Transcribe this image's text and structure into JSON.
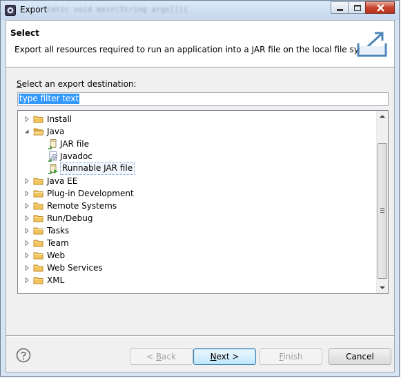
{
  "window": {
    "title": "Export",
    "background_ghost_text": "tatic void main(String args[]){"
  },
  "header": {
    "title": "Select",
    "description": "Export all resources required to run an application into a JAR file on the local file system."
  },
  "destination": {
    "label_mnemonic": "S",
    "label_rest": "elect an export destination:",
    "filter_value": "type filter text"
  },
  "tree": {
    "items": [
      {
        "label": "Install",
        "icon": "folder-icon",
        "state": "collapsed",
        "level": 0
      },
      {
        "label": "Java",
        "icon": "folder-open-icon",
        "state": "expanded",
        "level": 0
      },
      {
        "label": "JAR file",
        "icon": "jar-file-icon",
        "state": "leaf",
        "level": 1
      },
      {
        "label": "Javadoc",
        "icon": "javadoc-icon",
        "state": "leaf",
        "level": 1
      },
      {
        "label": "Runnable JAR file",
        "icon": "runnable-jar-icon",
        "state": "leaf",
        "level": 1,
        "selected": true
      },
      {
        "label": "Java EE",
        "icon": "folder-icon",
        "state": "collapsed",
        "level": 0
      },
      {
        "label": "Plug-in Development",
        "icon": "folder-icon",
        "state": "collapsed",
        "level": 0
      },
      {
        "label": "Remote Systems",
        "icon": "folder-icon",
        "state": "collapsed",
        "level": 0
      },
      {
        "label": "Run/Debug",
        "icon": "folder-icon",
        "state": "collapsed",
        "level": 0
      },
      {
        "label": "Tasks",
        "icon": "folder-icon",
        "state": "collapsed",
        "level": 0
      },
      {
        "label": "Team",
        "icon": "folder-icon",
        "state": "collapsed",
        "level": 0
      },
      {
        "label": "Web",
        "icon": "folder-icon",
        "state": "collapsed",
        "level": 0
      },
      {
        "label": "Web Services",
        "icon": "folder-icon",
        "state": "collapsed",
        "level": 0
      },
      {
        "label": "XML",
        "icon": "folder-icon",
        "state": "collapsed",
        "level": 0
      }
    ]
  },
  "buttons": {
    "back": {
      "label": "< Back",
      "mnemonic": "B",
      "enabled": false
    },
    "next": {
      "label": "Next >",
      "mnemonic": "N",
      "enabled": true,
      "default": true
    },
    "finish": {
      "label": "Finish",
      "mnemonic": "F",
      "enabled": false
    },
    "cancel": {
      "label": "Cancel",
      "enabled": true
    }
  },
  "colors": {
    "selection_highlight": "#3399ff",
    "folder": "#f2c55c",
    "close_button": "#c7452f"
  }
}
